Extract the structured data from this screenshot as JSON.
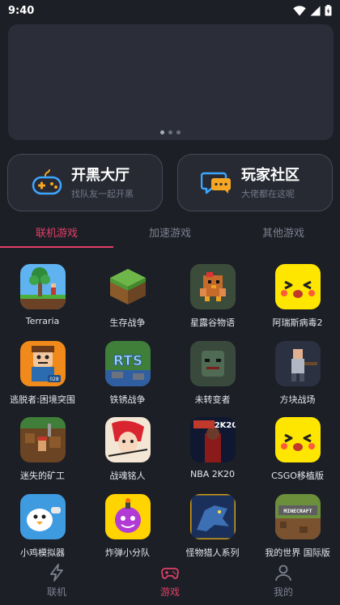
{
  "status": {
    "time": "9:40"
  },
  "cards": [
    {
      "title": "开黑大厅",
      "subtitle": "找队友一起开黑",
      "icon": "gamepad-icon"
    },
    {
      "title": "玩家社区",
      "subtitle": "大佬都在这呢",
      "icon": "chat-bubble-icon"
    }
  ],
  "tabs": [
    {
      "label": "联机游戏",
      "active": true
    },
    {
      "label": "加速游戏",
      "active": false
    },
    {
      "label": "其他游戏",
      "active": false
    }
  ],
  "games": [
    {
      "name": "Terraria",
      "icon": "terraria-game-icon"
    },
    {
      "name": "生存战争",
      "icon": "survivalcraft-game-icon"
    },
    {
      "name": "星露谷物语",
      "icon": "stardew-valley-game-icon"
    },
    {
      "name": "阿瑞斯病毒2",
      "icon": "yellow-face-game-icon"
    },
    {
      "name": "逃脱者:困境突围",
      "icon": "escapists-game-icon"
    },
    {
      "name": "铁锈战争",
      "icon": "rusted-warfare-game-icon"
    },
    {
      "name": "未转变者",
      "icon": "unturned-game-icon"
    },
    {
      "name": "方块战场",
      "icon": "block-battlefield-game-icon"
    },
    {
      "name": "迷失的矿工",
      "icon": "lost-miner-game-icon"
    },
    {
      "name": "战魂铭人",
      "icon": "soul-knight-game-icon"
    },
    {
      "name": "NBA 2K20",
      "icon": "nba-2k20-game-icon"
    },
    {
      "name": "CSGO移植版",
      "icon": "yellow-face-game-icon"
    },
    {
      "name": "小鸡模拟器",
      "icon": "chick-emulator-game-icon"
    },
    {
      "name": "炸弹小分队",
      "icon": "bomb-squad-game-icon"
    },
    {
      "name": "怪物猎人系列",
      "icon": "monster-hunter-game-icon"
    },
    {
      "name": "我的世界 国际版",
      "icon": "minecraft-game-icon"
    }
  ],
  "game_badges": {
    "nba": "2K20",
    "escapists": "028",
    "minecraft": "MINECRAFT",
    "rts": "RTS"
  },
  "nav": [
    {
      "label": "联机",
      "icon": "lightning-icon",
      "active": false
    },
    {
      "label": "游戏",
      "icon": "gamepad-icon",
      "active": true
    },
    {
      "label": "我的",
      "icon": "person-icon",
      "active": false
    }
  ],
  "colors": {
    "accent": "#e23f67",
    "background": "#1d1f26",
    "card": "#272a33",
    "muted": "#7d8290"
  }
}
